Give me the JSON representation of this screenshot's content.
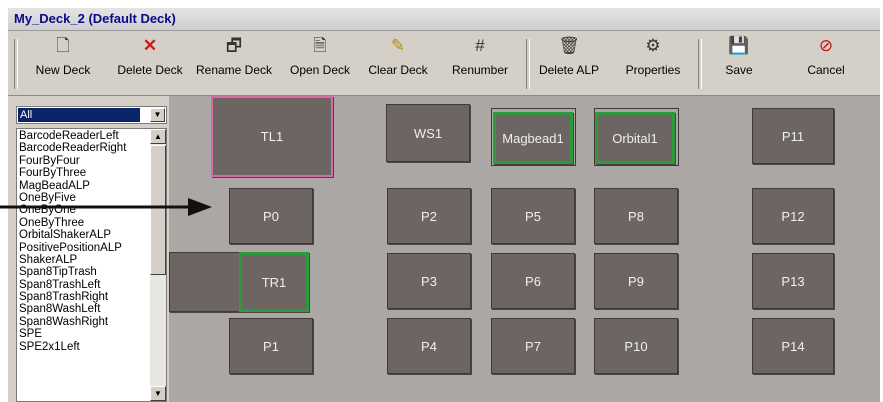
{
  "window": {
    "title": "My_Deck_2 (Default Deck)"
  },
  "toolbar": {
    "buttons": [
      {
        "label": "New Deck",
        "icon": "new-document-icon"
      },
      {
        "label": "Delete Deck",
        "icon": "red-x-icon"
      },
      {
        "label": "Rename Deck",
        "icon": "rename-icon"
      },
      {
        "label": "Open Deck",
        "icon": "open-document-icon"
      },
      {
        "label": "Clear Deck",
        "icon": "brush-icon"
      },
      {
        "label": "Renumber",
        "icon": "renumber-icon"
      },
      {
        "label": "Delete ALP",
        "icon": "trash-icon"
      },
      {
        "label": "Properties",
        "icon": "properties-icon"
      },
      {
        "label": "Save",
        "icon": "save-icon"
      },
      {
        "label": "Cancel",
        "icon": "cancel-icon"
      }
    ]
  },
  "filter": {
    "selected": "All"
  },
  "alp_list": [
    "BarcodeReaderLeft",
    "BarcodeReaderRight",
    "FourByFour",
    "FourByThree",
    "MagBeadALP",
    "OneByFive",
    "OneByOne",
    "OneByThree",
    "OrbitalShakerALP",
    "PositivePositionALP",
    "ShakerALP",
    "Span8TipTrash",
    "Span8TrashLeft",
    "Span8TrashRight",
    "Span8WashLeft",
    "Span8WashRight",
    "SPE",
    "SPE2x1Left"
  ],
  "deck": {
    "positions": [
      "TL1",
      "WS1",
      "Magbead1",
      "Orbital1",
      "P11",
      "P0",
      "P2",
      "P5",
      "P8",
      "P12",
      "TR1",
      "P3",
      "P6",
      "P9",
      "P13",
      "P1",
      "P4",
      "P7",
      "P10",
      "P14"
    ]
  },
  "colors": {
    "deck_bg": "#aba7a4",
    "position_fill": "#6c6562",
    "highlight_green": "#2f9a3c",
    "selected_pink": "#d96aa8"
  }
}
